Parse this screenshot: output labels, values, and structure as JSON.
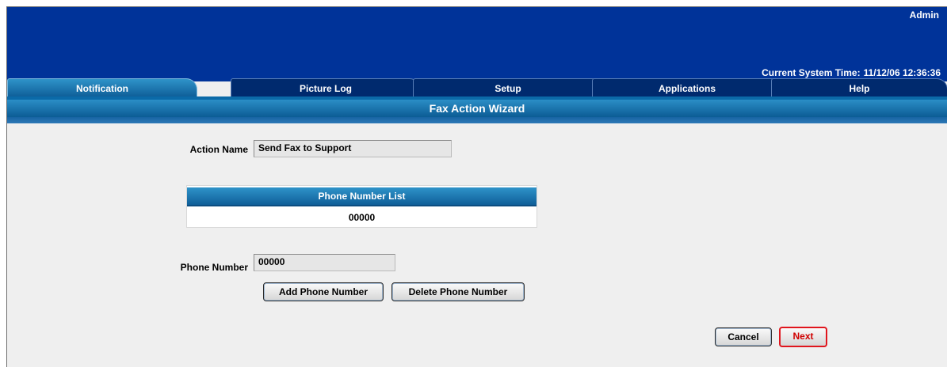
{
  "header": {
    "user": "Admin",
    "system_time_label": "Current System Time:",
    "system_time_value": "11/12/06 12:36:36"
  },
  "tabs": [
    {
      "label": "Notification",
      "active": true
    },
    {
      "label": "Picture Log",
      "active": false
    },
    {
      "label": "Setup",
      "active": false
    },
    {
      "label": "Applications",
      "active": false
    },
    {
      "label": "Help",
      "active": false
    }
  ],
  "wizard": {
    "title": "Fax Action Wizard",
    "action_name_label": "Action Name",
    "action_name_value": "Send Fax to Support",
    "phone_list_title": "Phone Number List",
    "phone_list_items": [
      "00000"
    ],
    "phone_number_label": "Phone Number",
    "phone_number_value": "00000",
    "add_button": "Add Phone Number",
    "delete_button": "Delete Phone Number",
    "cancel_button": "Cancel",
    "next_button": "Next"
  },
  "colors": {
    "banner": "#003399",
    "tab_inactive": "#002a6e",
    "tab_active": "#1f7ab5",
    "next_border": "#e0151d"
  }
}
